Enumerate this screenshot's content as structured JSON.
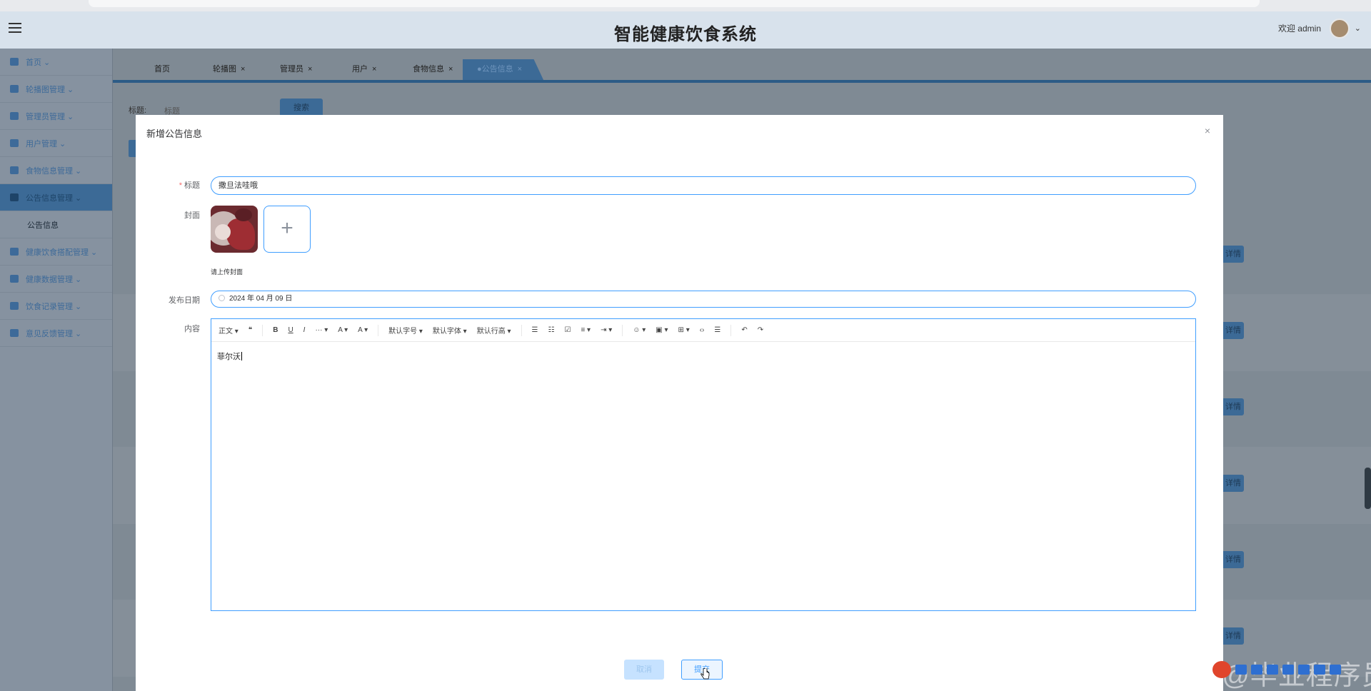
{
  "app": {
    "title": "智能健康饮食系统",
    "welcome": "欢迎 admin",
    "user_menu_chevron": "⌄"
  },
  "sidebar": {
    "items": [
      {
        "label": "首页 ⌄",
        "icon": "home-icon"
      },
      {
        "label": "轮播图管理 ⌄",
        "icon": "carousel-icon"
      },
      {
        "label": "管理员管理 ⌄",
        "icon": "admin-icon"
      },
      {
        "label": "用户管理 ⌄",
        "icon": "user-icon"
      },
      {
        "label": "食物信息管理 ⌄",
        "icon": "food-icon"
      },
      {
        "label": "公告信息管理 ⌄",
        "icon": "notice-icon"
      },
      {
        "label": "健康饮食搭配管理 ⌄",
        "icon": "diet-icon"
      },
      {
        "label": "健康数据管理 ⌄",
        "icon": "data-icon"
      },
      {
        "label": "饮食记录管理 ⌄",
        "icon": "record-icon"
      },
      {
        "label": "意见反馈管理 ⌄",
        "icon": "feedback-icon"
      }
    ],
    "sub_item": "公告信息"
  },
  "tabs": [
    {
      "label": "首页",
      "closable": false
    },
    {
      "label": "轮播图",
      "closable": true
    },
    {
      "label": "管理员",
      "closable": true
    },
    {
      "label": "用户",
      "closable": true
    },
    {
      "label": "食物信息",
      "closable": true
    },
    {
      "label": "●公告信息",
      "closable": true
    }
  ],
  "search": {
    "label": "标题:",
    "placeholder": "标题",
    "button": "搜索"
  },
  "table": {
    "detail_button": "详情"
  },
  "modal": {
    "title": "新增公告信息",
    "close": "×",
    "fields": {
      "title_label": "标题",
      "title_required": "*",
      "title_value": "撒旦法哇哦",
      "cover_label": "封面",
      "cover_tip": "请上传封面",
      "date_label": "发布日期",
      "date_value": "2024 年 04 月 09 日",
      "content_label": "内容",
      "content_value": "菲尔沃"
    },
    "toolbar": [
      "正文 ▾",
      "❝",
      "B",
      "U",
      "I",
      "··· ▾",
      "A ▾",
      "A ▾",
      "默认字号 ▾",
      "默认字体 ▾",
      "默认行高 ▾",
      "☰",
      "☷",
      "☑",
      "≡ ▾",
      "⇥ ▾",
      "☺ ▾",
      "▣ ▾",
      "⊞ ▾",
      "‹›",
      "☰",
      "↶",
      "↷"
    ],
    "buttons": {
      "cancel": "取消",
      "submit": "提交"
    }
  },
  "watermark": "CSDN @毕业程序员",
  "colors": {
    "primary": "#409eff",
    "required": "#f56c6c",
    "overlay_accent": "#3c6a96"
  }
}
